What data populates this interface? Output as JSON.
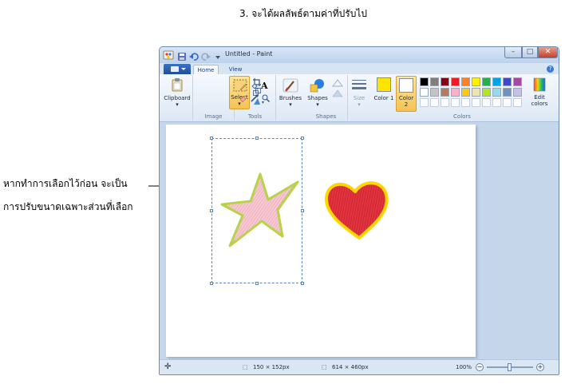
{
  "document": {
    "heading": "3. จะได้ผลลัพธ์ตามค่าที่ปรับไป",
    "caption_line1": "หากทำการเลือกไว้ก่อน จะเป็น",
    "caption_line2": "การปรับขนาดเฉพาะส่วนที่เลือก"
  },
  "window": {
    "title": "Untitled - Paint",
    "controls": {
      "minimize": "–",
      "maximize": "□",
      "close": "✕"
    }
  },
  "tabs": {
    "home": "Home",
    "view": "View"
  },
  "ribbon": {
    "clipboard_label": "Clipboard",
    "select_label": "Select",
    "image_group": "Image",
    "tools_group": "Tools",
    "brushes_label": "Brushes",
    "shapes_label": "Shapes",
    "shapes_group": "Shapes",
    "size_label": "Size",
    "color1_label": "Color 1",
    "color2_label": "Color 2",
    "colors_group": "Colors",
    "edit_colors_label": "Edit colors",
    "color1_value": "#ffe400",
    "color2_value": "#ffffff",
    "palette_row1": [
      "#000000",
      "#7f7f7f",
      "#880015",
      "#ed1c24",
      "#ff7f27",
      "#fff200",
      "#22b14c",
      "#00a2e8",
      "#3f48cc",
      "#a349a4"
    ],
    "palette_row2": [
      "#ffffff",
      "#c3c3c3",
      "#b97a57",
      "#ffaec9",
      "#ffc90e",
      "#efe4b0",
      "#b5e61d",
      "#99d9ea",
      "#7092be",
      "#c8bfe7"
    ]
  },
  "icons": {
    "app": "paint-app-icon",
    "save": "save-icon",
    "undo": "undo-icon",
    "redo": "redo-icon",
    "help": "help-icon"
  },
  "status": {
    "selection_size": "150 × 152px",
    "canvas_size": "614 × 460px",
    "zoom": "100%"
  }
}
